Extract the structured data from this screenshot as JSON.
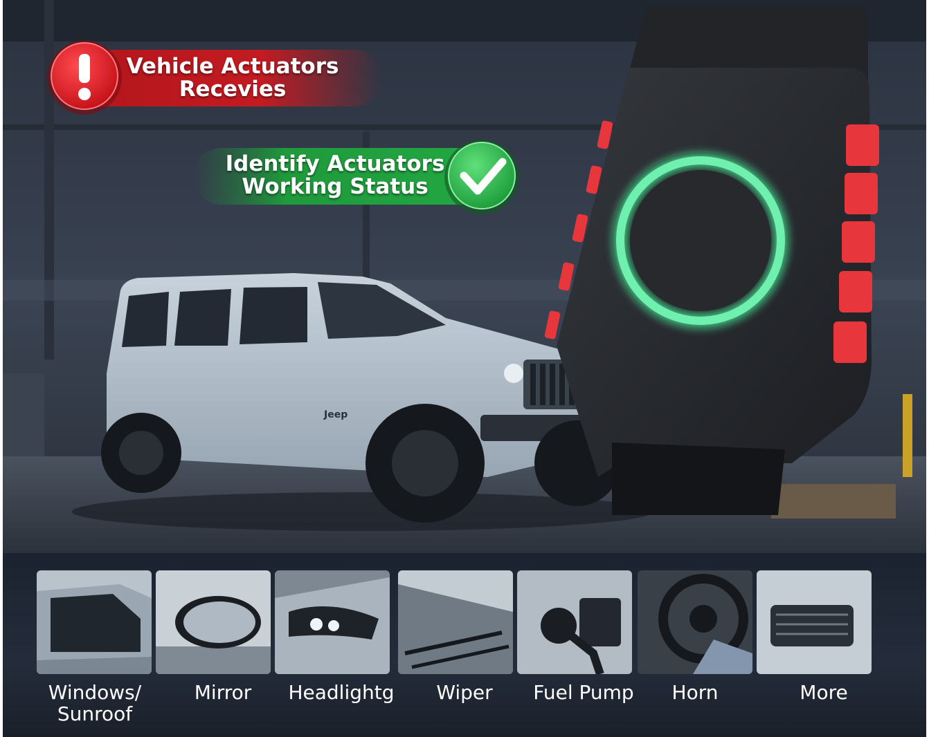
{
  "banners": {
    "alert_text": "Vehicle Actuators\nRecevies",
    "status_text": "Identify Actuators\nWorking Status",
    "alert_icon": "exclamation-icon",
    "status_icon": "checkmark-icon"
  },
  "vehicle": {
    "badge": "Jeep"
  },
  "actuators": [
    {
      "label": "Windows/\nSunroof",
      "icon": "car-window-photo"
    },
    {
      "label": "Mirror",
      "icon": "side-mirror-photo"
    },
    {
      "label": "Headlightg",
      "icon": "headlight-photo"
    },
    {
      "label": "Wiper",
      "icon": "wiper-photo"
    },
    {
      "label": "Fuel Pump",
      "icon": "fuel-nozzle-photo"
    },
    {
      "label": "Horn",
      "icon": "steering-wheel-photo"
    },
    {
      "label": "More",
      "icon": "dashboard-vent-photo"
    }
  ],
  "colors": {
    "alert_red": "#c8161d",
    "status_green": "#1f9a3c",
    "ring_green": "#4ee59a",
    "device_body": "#2a2c30",
    "button_red": "#e8363d"
  }
}
